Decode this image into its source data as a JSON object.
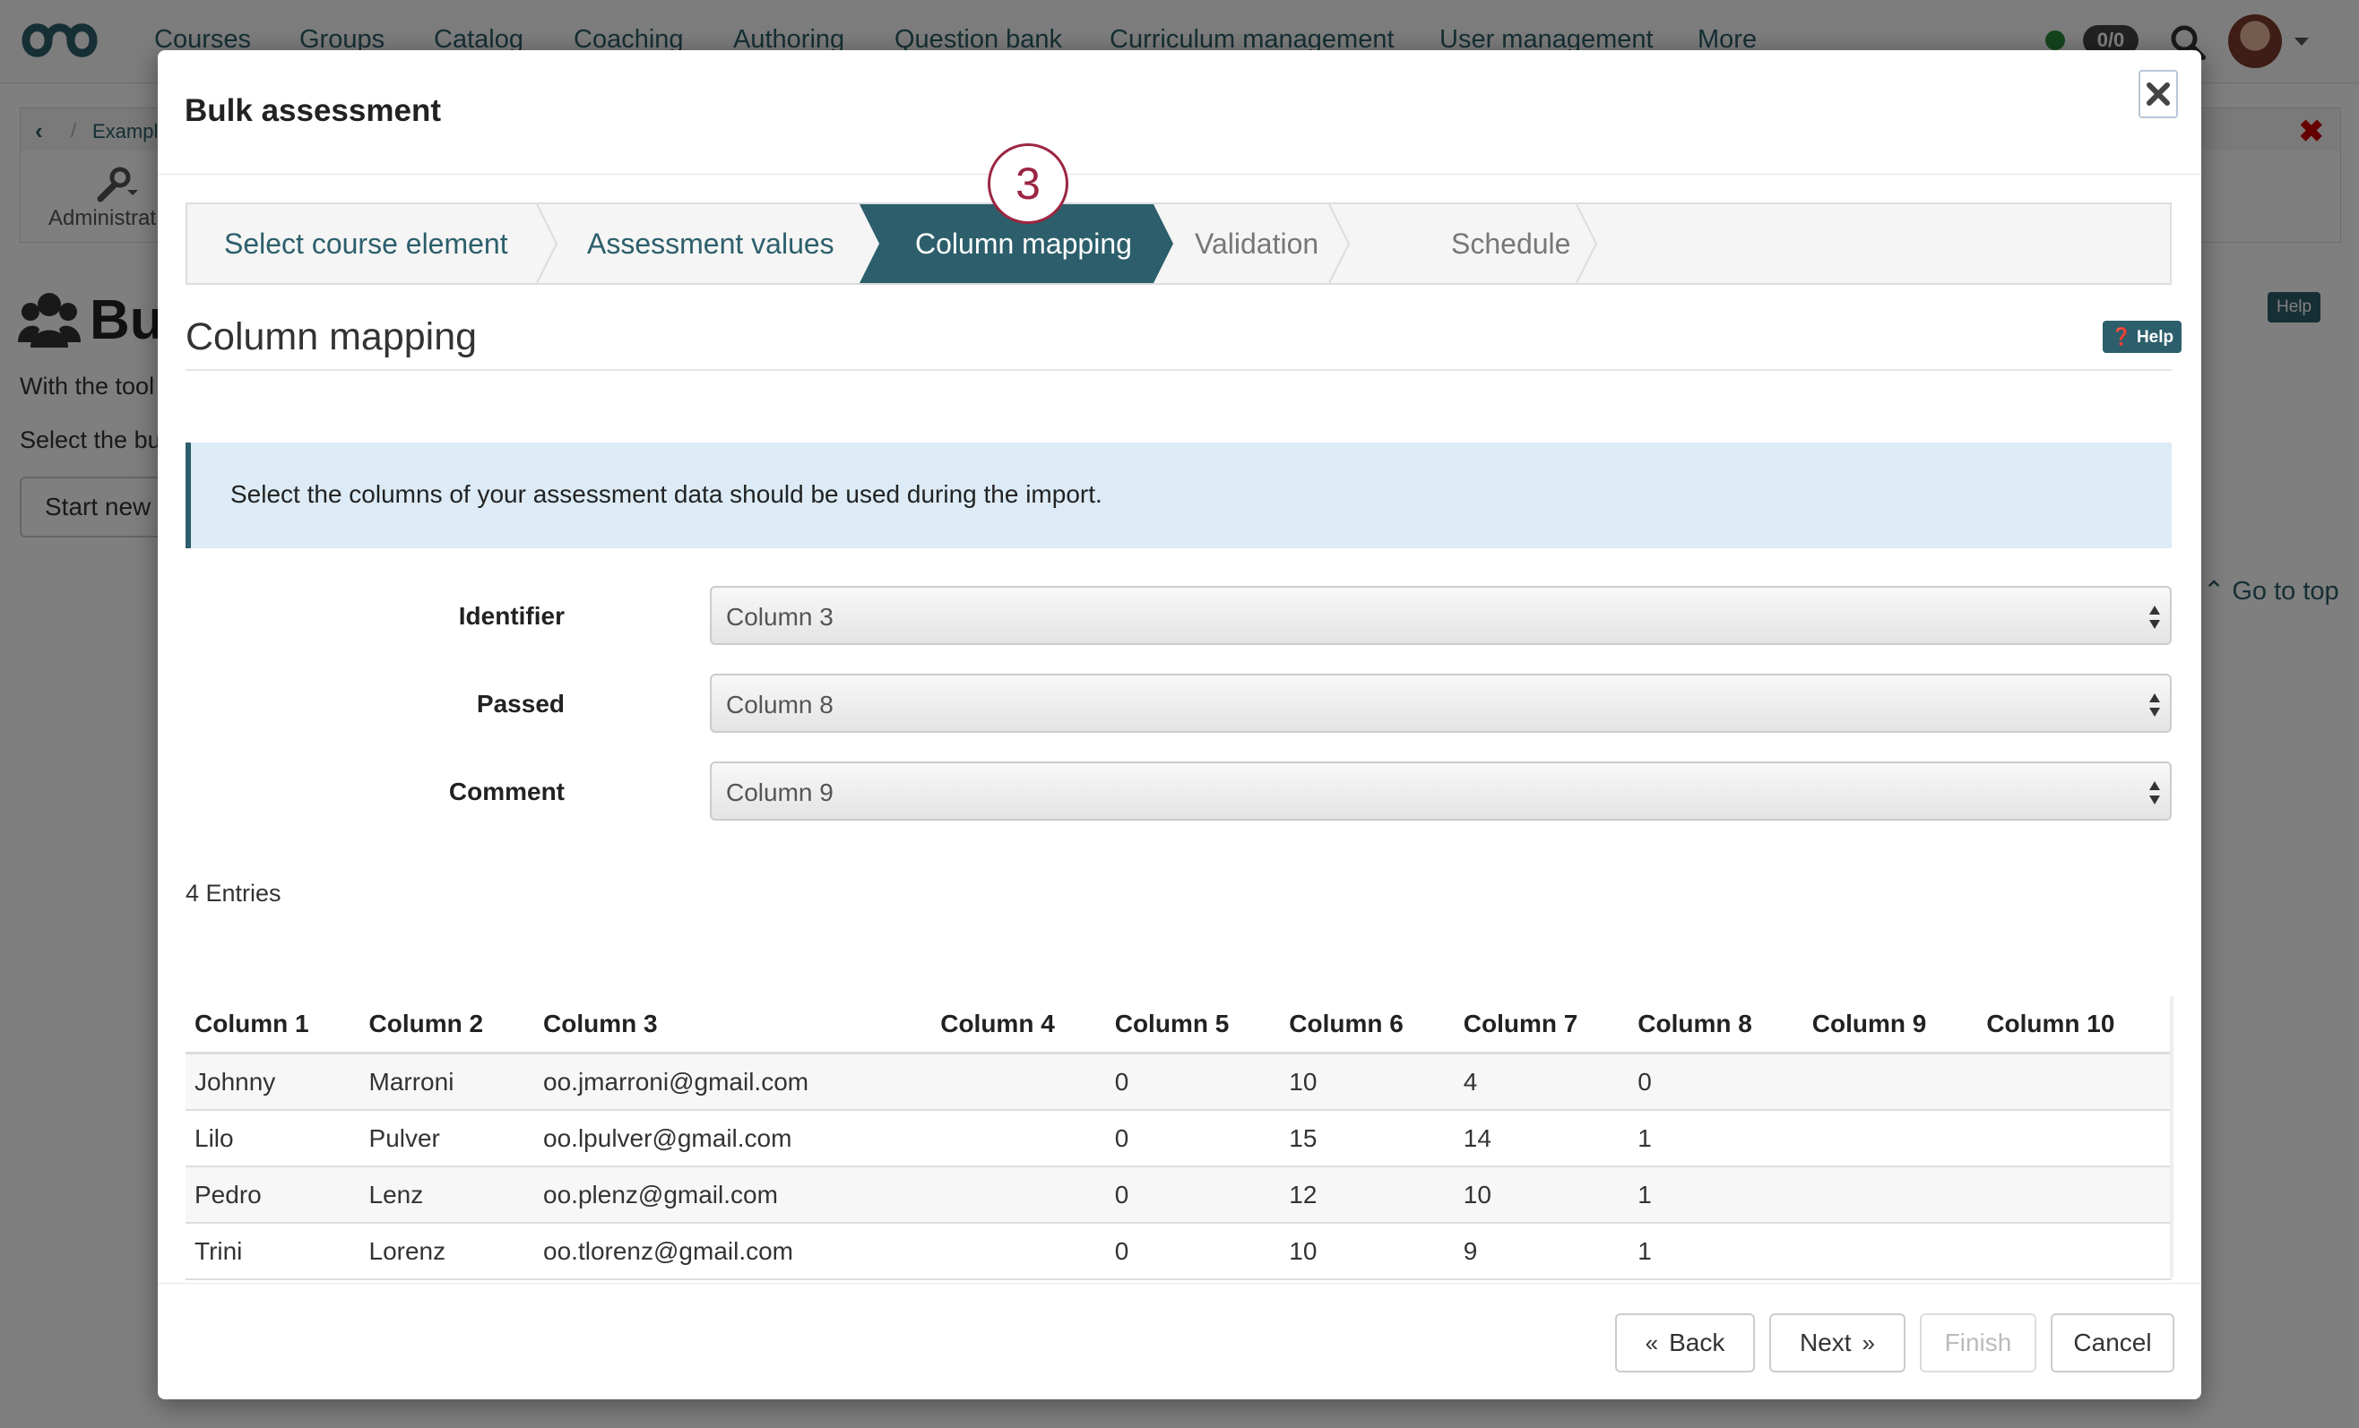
{
  "nav": {
    "items": [
      "Courses",
      "Groups",
      "Catalog",
      "Coaching",
      "Authoring",
      "Question bank",
      "Curriculum management",
      "User management",
      "More"
    ],
    "notifications": "0/0"
  },
  "background": {
    "breadcrumb": "Exampl",
    "admin_label": "Administrat",
    "title": "Bu",
    "text1": "With the tool",
    "text2": "Select the bu",
    "start_button": "Start new b",
    "help_label": "Help",
    "go_to_top": "Go to top"
  },
  "modal": {
    "title": "Bulk assessment",
    "wizard": {
      "steps": [
        "Select course element",
        "Assessment values",
        "Column mapping",
        "Validation",
        "Schedule"
      ],
      "active_step_number": "3"
    },
    "section_title": "Column mapping",
    "help_label": "Help",
    "info_text": "Select the columns of your assessment data should be used during the import.",
    "form": {
      "identifier": {
        "label": "Identifier",
        "value": "Column 3"
      },
      "passed": {
        "label": "Passed",
        "value": "Column 8"
      },
      "comment": {
        "label": "Comment",
        "value": "Column 9"
      }
    },
    "entries_count": "4 Entries",
    "table": {
      "headers": [
        "Column 1",
        "Column 2",
        "Column 3",
        "Column 4",
        "Column 5",
        "Column 6",
        "Column 7",
        "Column 8",
        "Column 9",
        "Column 10"
      ],
      "rows": [
        [
          "Johnny",
          "Marroni",
          "oo.jmarroni@gmail.com",
          "",
          "0",
          "10",
          "4",
          "0",
          "",
          ""
        ],
        [
          "Lilo",
          "Pulver",
          "oo.lpulver@gmail.com",
          "",
          "0",
          "15",
          "14",
          "1",
          "",
          ""
        ],
        [
          "Pedro",
          "Lenz",
          "oo.plenz@gmail.com",
          "",
          "0",
          "12",
          "10",
          "1",
          "",
          ""
        ],
        [
          "Trini",
          "Lorenz",
          "oo.tlorenz@gmail.com",
          "",
          "0",
          "10",
          "9",
          "1",
          "",
          ""
        ]
      ]
    },
    "buttons": {
      "back": "Back",
      "next": "Next",
      "finish": "Finish",
      "cancel": "Cancel"
    }
  },
  "colors": {
    "accent": "#2c5f6b",
    "step_circle": "#9b2642",
    "info_bg": "#dcebf5"
  }
}
